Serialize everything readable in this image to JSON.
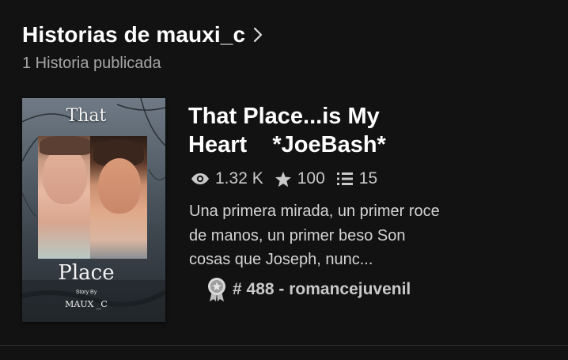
{
  "header": {
    "title": "Historias de mauxi_c",
    "subtitle": "1 Historia publicada"
  },
  "story": {
    "title": "That Place...is My\nHeart    *JoeBash*",
    "stats": {
      "views": "1.32 K",
      "votes": "100",
      "parts": "15"
    },
    "description": "Una primera mirada, un primer roce de manos, un primer beso Son cosas que Joseph, nunc...",
    "ranking": "# 488 - romancejuvenil",
    "cover": {
      "title_top": "That",
      "title_bottom": "Place",
      "story_by": "Story By",
      "author": "MAUX _C"
    }
  },
  "colors": {
    "background": "#121212",
    "primary_text": "#ffffff",
    "secondary_text": "#a6a6a6",
    "meta_text": "#c9c9c9"
  },
  "icons": {
    "header_chevron": "chevron-right-icon",
    "views": "eye-icon",
    "votes": "star-icon",
    "parts": "list-icon",
    "ranking": "award-ribbon-icon"
  }
}
